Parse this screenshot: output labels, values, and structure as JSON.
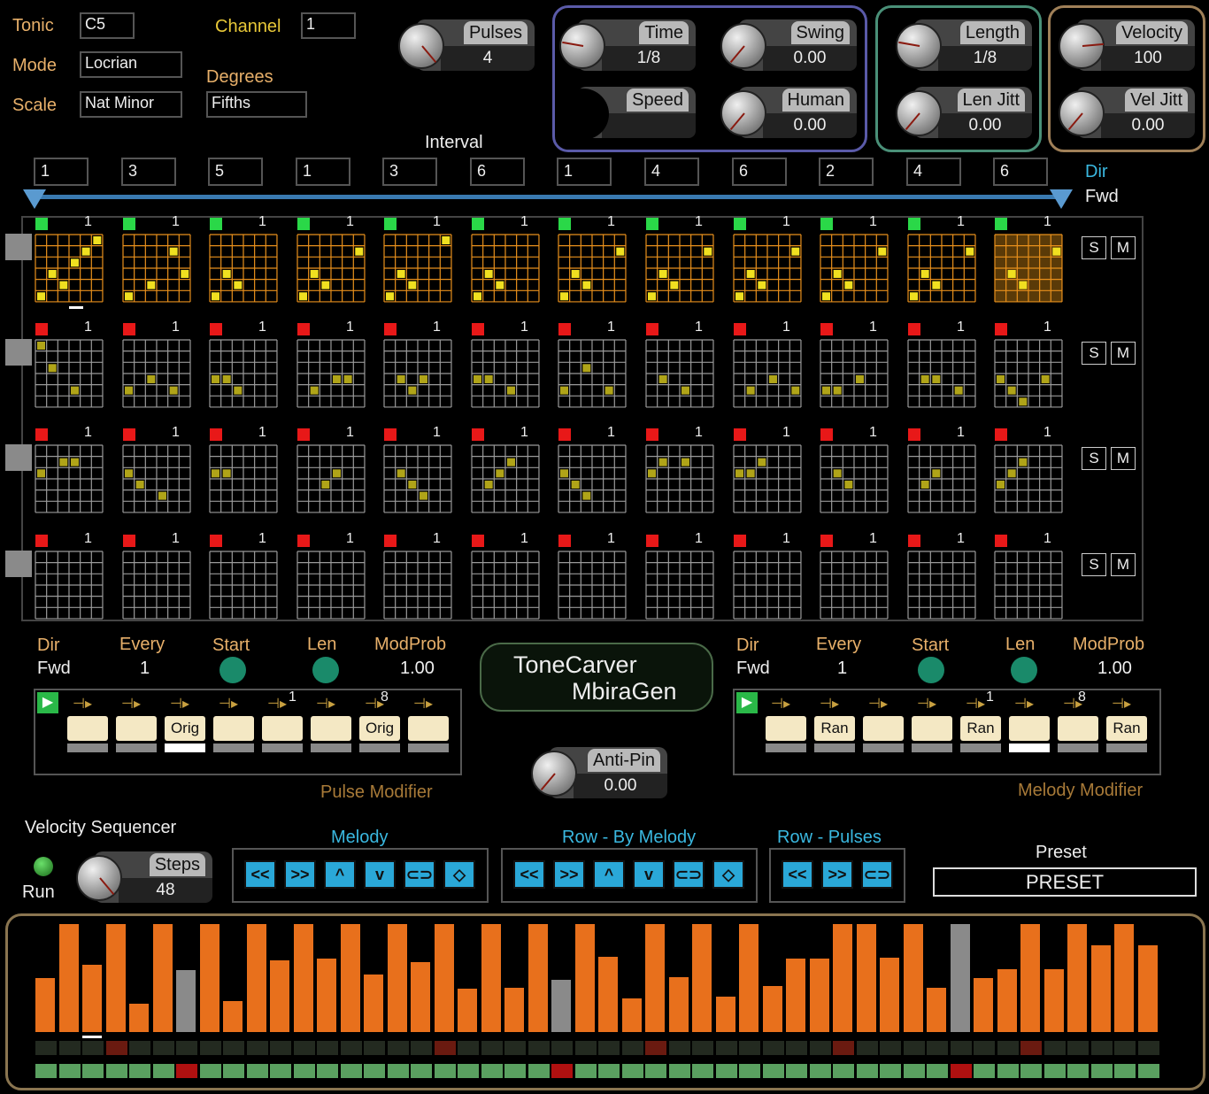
{
  "top": {
    "tonic_label": "Tonic",
    "tonic_value": "C5",
    "mode_label": "Mode",
    "mode_value": "Locrian",
    "scale_label": "Scale",
    "scale_value": "Nat Minor",
    "channel_label": "Channel",
    "channel_value": "1",
    "degrees_label": "Degrees",
    "degrees_value": "Fifths"
  },
  "knobs": {
    "pulses": {
      "label": "Pulses",
      "value": "4"
    },
    "time": {
      "label": "Time",
      "value": "1/8"
    },
    "swing": {
      "label": "Swing",
      "value": "0.00"
    },
    "speed": {
      "label": "Speed",
      "value": ""
    },
    "human": {
      "label": "Human",
      "value": "0.00"
    },
    "length": {
      "label": "Length",
      "value": "1/8"
    },
    "len_jitt": {
      "label": "Len Jitt",
      "value": "0.00"
    },
    "velocity": {
      "label": "Velocity",
      "value": "100"
    },
    "vel_jitt": {
      "label": "Vel Jitt",
      "value": "0.00"
    },
    "anti_pin": {
      "label": "Anti-Pin",
      "value": "0.00"
    },
    "steps": {
      "label": "Steps",
      "value": "48"
    }
  },
  "interval": {
    "label": "Interval",
    "values": [
      "1",
      "3",
      "5",
      "1",
      "3",
      "6",
      "1",
      "4",
      "6",
      "2",
      "4",
      "6"
    ],
    "dir_label": "Dir",
    "dir_value": "Fwd"
  },
  "rows": [
    {
      "indicator": "green",
      "counts": [
        "1",
        "1",
        "1",
        "1",
        "1",
        "1",
        "1",
        "1",
        "1",
        "1",
        "1",
        "1"
      ]
    },
    {
      "indicator": "red",
      "counts": [
        "1",
        "1",
        "1",
        "1",
        "1",
        "1",
        "1",
        "1",
        "1",
        "1",
        "1",
        "1"
      ]
    },
    {
      "indicator": "red",
      "counts": [
        "1",
        "1",
        "1",
        "1",
        "1",
        "1",
        "1",
        "1",
        "1",
        "1",
        "1",
        "1"
      ]
    },
    {
      "indicator": "red",
      "counts": [
        "1",
        "1",
        "1",
        "1",
        "1",
        "1",
        "1",
        "1",
        "1",
        "1",
        "1",
        "1"
      ]
    }
  ],
  "solo_label": "S",
  "mute_label": "M",
  "pulse_mod": {
    "dir_label": "Dir",
    "dir_value": "Fwd",
    "every_label": "Every",
    "every_value": "1",
    "start_label": "Start",
    "len_label": "Len",
    "modprob_label": "ModProb",
    "modprob_value": "1.00",
    "buttons": [
      "",
      "",
      "Orig",
      "",
      "",
      "",
      "Orig",
      ""
    ],
    "marker_a": "1",
    "marker_b": "8",
    "title": "Pulse Modifier"
  },
  "melody_mod": {
    "dir_label": "Dir",
    "dir_value": "Fwd",
    "every_label": "Every",
    "every_value": "1",
    "start_label": "Start",
    "len_label": "Len",
    "modprob_label": "ModProb",
    "modprob_value": "1.00",
    "buttons": [
      "",
      "Ran",
      "",
      "",
      "Ran",
      "",
      "",
      "Ran"
    ],
    "marker_a": "1",
    "marker_b": "8",
    "title": "Melody Modifier"
  },
  "logo": {
    "line1": "ToneCarver",
    "line2": "MbiraGen"
  },
  "velseq": {
    "title": "Velocity Sequencer",
    "run_label": "Run"
  },
  "transport": {
    "melody_label": "Melody",
    "melody_buttons": [
      "<<",
      ">>",
      "^",
      "v",
      "⊂⊃",
      "◇"
    ],
    "row_melody_label": "Row - By Melody",
    "row_melody_buttons": [
      "<<",
      ">>",
      "^",
      "v",
      "⊂⊃",
      "◇"
    ],
    "row_pulses_label": "Row - Pulses",
    "row_pulses_buttons": [
      "<<",
      ">>",
      "⊂⊃"
    ]
  },
  "preset": {
    "label": "Preset",
    "value": "PRESET"
  },
  "velocity_bars": [
    0.5,
    1.0,
    0.62,
    1.0,
    0.26,
    1.0,
    0.57,
    1.0,
    0.29,
    1.0,
    0.66,
    1.0,
    0.68,
    1.0,
    0.53,
    1.0,
    0.65,
    1.0,
    0.4,
    1.0,
    0.41,
    1.0,
    0.48,
    1.0,
    0.7,
    0.31,
    1.0,
    0.51,
    1.0,
    0.33,
    1.0,
    0.43,
    0.68,
    0.68,
    1.0,
    1.0,
    0.69,
    1.0,
    0.41,
    1.0,
    0.5,
    0.58,
    1.0,
    0.58,
    1.0,
    0.8,
    1.0,
    0.8
  ],
  "colors": {
    "bar": "#e8701c",
    "bar_gray": "#8a8a8a",
    "grid_orange": "#e8901c",
    "grid_gray": "#9a9a9a",
    "note_yellow": "#f0e020",
    "note_olive": "#b0a418"
  }
}
